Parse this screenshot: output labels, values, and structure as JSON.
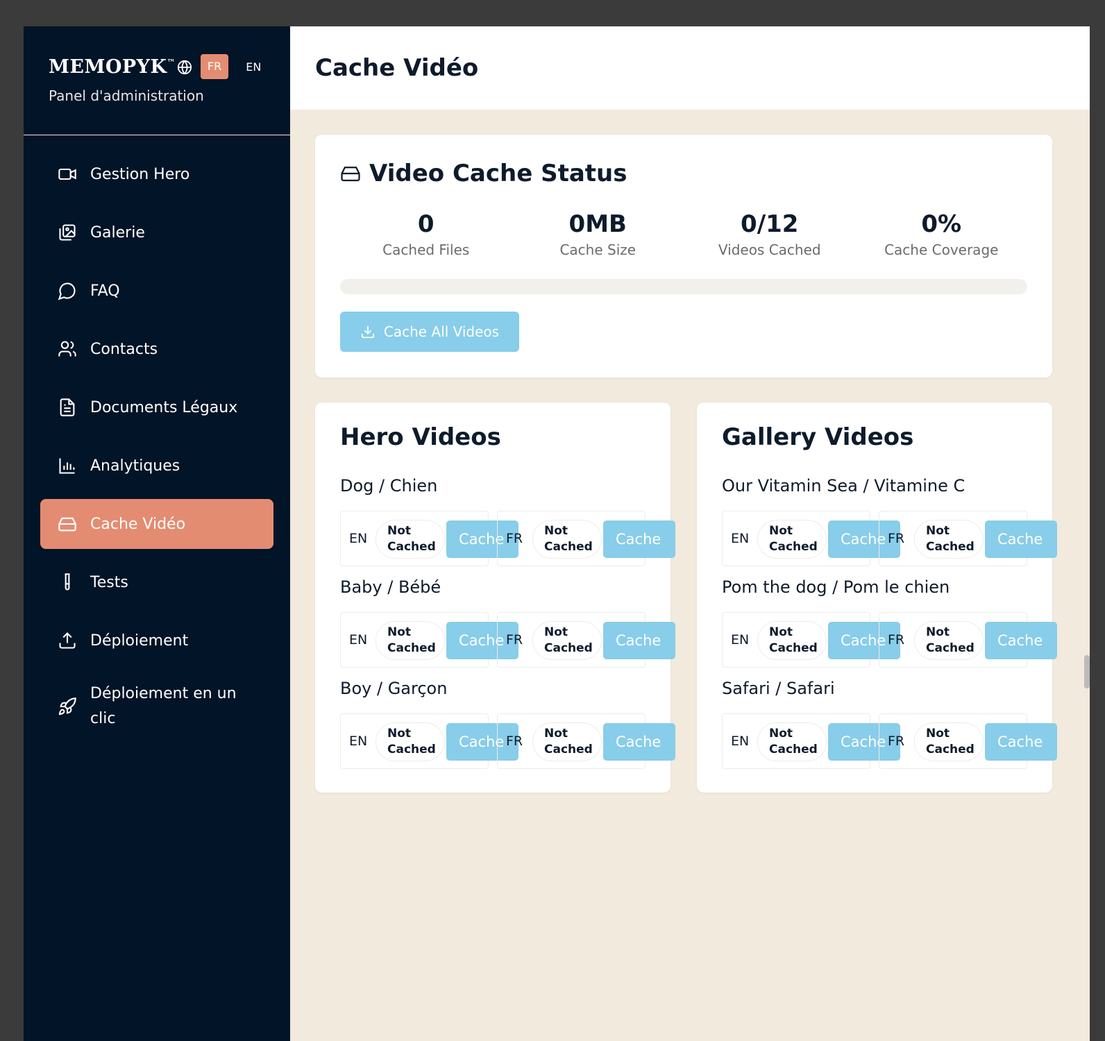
{
  "brand": {
    "logo": "MEMOPYK",
    "tm": "™",
    "lang_fr": "FR",
    "lang_en": "EN",
    "subtitle": "Panel d'administration"
  },
  "nav": [
    {
      "label": "Gestion Hero",
      "icon": "video-camera-icon"
    },
    {
      "label": "Galerie",
      "icon": "gallery-icon"
    },
    {
      "label": "FAQ",
      "icon": "chat-bubble-icon"
    },
    {
      "label": "Contacts",
      "icon": "users-icon"
    },
    {
      "label": "Documents Légaux",
      "icon": "document-icon"
    },
    {
      "label": "Analytiques",
      "icon": "bar-chart-icon"
    },
    {
      "label": "Cache Vidéo",
      "icon": "hard-drive-icon",
      "active": true
    },
    {
      "label": "Tests",
      "icon": "test-tube-icon"
    },
    {
      "label": "Déploiement",
      "icon": "upload-icon"
    },
    {
      "label": "Déploiement en un clic",
      "icon": "rocket-icon"
    }
  ],
  "page": {
    "title": "Cache Vidéo"
  },
  "status": {
    "title": "Video Cache Status",
    "stats": [
      {
        "value": "0",
        "label": "Cached Files"
      },
      {
        "value": "0MB",
        "label": "Cache Size"
      },
      {
        "value": "0/12",
        "label": "Videos Cached"
      },
      {
        "value": "0%",
        "label": "Cache Coverage"
      }
    ],
    "progress": 0,
    "cache_all_label": "Cache All Videos"
  },
  "hero": {
    "title": "Hero Videos",
    "videos": [
      {
        "name": "Dog / Chien"
      },
      {
        "name": "Baby / Bébé"
      },
      {
        "name": "Boy / Garçon"
      }
    ]
  },
  "gallery": {
    "title": "Gallery Videos",
    "videos": [
      {
        "name": "Our Vitamin Sea / Vitamine C"
      },
      {
        "name": "Pom the dog / Pom le chien"
      },
      {
        "name": "Safari / Safari"
      }
    ]
  },
  "video_row": {
    "lang_en": "EN",
    "lang_fr": "FR",
    "status_line1": "Not",
    "status_line2": "Cached",
    "cache_label": "Cache"
  },
  "colors": {
    "sidebar": "#021427",
    "accent": "#e48c72",
    "button": "#88cde9",
    "background": "#f2eadc"
  }
}
